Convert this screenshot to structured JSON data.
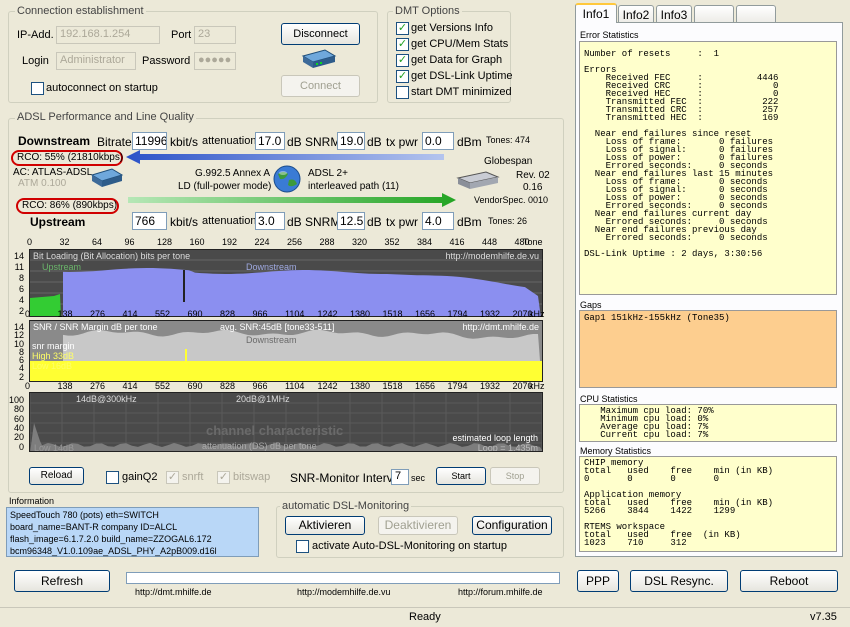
{
  "conn": {
    "title": "Connection establishment",
    "ip_label": "IP-Add.",
    "ip_value": "192.168.1.254",
    "port_label": "Port",
    "port_value": "23",
    "login_label": "Login",
    "login_value": "Administrator",
    "password_label": "Password",
    "password_value": "●●●●●",
    "autoconnect_label": "autoconnect on startup",
    "disconnect": "Disconnect",
    "connect": "Connect"
  },
  "dmt": {
    "title": "DMT Options",
    "opts": [
      {
        "label": "get Versions Info",
        "checked": true
      },
      {
        "label": "get CPU/Mem Stats",
        "checked": true
      },
      {
        "label": "get Data for Graph",
        "checked": true
      },
      {
        "label": "get DSL-Link Uptime",
        "checked": true
      },
      {
        "label": "start DMT minimized",
        "checked": false
      }
    ]
  },
  "adsl": {
    "title": "ADSL Performance and Line Quality",
    "down": {
      "label": "Downstream",
      "bitrate_label": "Bitrate",
      "bitrate": "11996",
      "unit": "kbit/s",
      "att_label": "attenuation",
      "att": "17.0",
      "db": "dB",
      "snrm_label": "SNRM",
      "snrm": "19.0",
      "txpwr_label": "tx pwr",
      "txpwr": "0.0",
      "dbm": "dBm",
      "tones": "Tones: 474",
      "rco": "RCO: 55% (21810kbps)"
    },
    "up": {
      "label": "Upstream",
      "bitrate": "766",
      "att": "3.0",
      "snrm": "12.5",
      "txpwr": "4.0",
      "tones": "Tones: 26",
      "rco": "RCO: 86% (890kbps)"
    },
    "ac": "AC: ATLAS-ADSL",
    "atm": "ATM 0.100",
    "mode1": "G.992.5 Annex A",
    "mode2": "LD (full-power mode)",
    "adsl2": "ADSL 2+",
    "path": "interleaved path (11)",
    "vendor": "Globespan",
    "rev": "Rev. 02",
    "rev2": "0.16",
    "vendorspec": "VendorSpec. 0010"
  },
  "graph": {
    "tone_label": "Tone",
    "khz_label": "kHz",
    "tones": [
      "0",
      "32",
      "64",
      "96",
      "128",
      "160",
      "192",
      "224",
      "256",
      "288",
      "320",
      "352",
      "384",
      "416",
      "448",
      "480"
    ],
    "khz": [
      "0",
      "138",
      "276",
      "414",
      "552",
      "690",
      "828",
      "966",
      "1104",
      "1242",
      "1380",
      "1518",
      "1656",
      "1794",
      "1932",
      "2070"
    ],
    "bit_title": "Bit Loading (Bit Allocation)  bits per tone",
    "bit_url": "http://modemhilfe.de.vu",
    "bit_y": [
      "14",
      "11",
      "8",
      "6",
      "4",
      "2"
    ],
    "up_mark": "Upstream",
    "down_mark": "Downstream",
    "snr_title": "SNR / SNR Margin  dB per tone",
    "snr_avg": "avg. SNR:45dB  [tone33-511]",
    "snr_url": "http://dmt.mhilfe.de",
    "snr_y": [
      "14",
      "12",
      "10",
      "8",
      "6",
      "4",
      "2"
    ],
    "snr_margin": "snr margin",
    "snr_high": "High 33dB",
    "snr_low": "Low  16dB",
    "ch_y": [
      "100",
      "80",
      "60",
      "40",
      "20",
      "0"
    ],
    "ch_a": "14dB@300kHz",
    "ch_b": "20dB@1MHz",
    "ch_title": "channel characteristic",
    "ch_att": "attenuation (DS)  dB per tone",
    "ch_est": "estimated loop length",
    "ch_len": "Loop = 1.435m",
    "ch_low": "Low  14dB"
  },
  "ctrl": {
    "reload": "Reload",
    "gainq2": "gainQ2",
    "snrft": "snrft",
    "bitswap": "bitswap",
    "interval_label": "SNR-Monitor Interval:",
    "interval": "7",
    "sec": "sec",
    "start": "Start",
    "stop": "Stop"
  },
  "info": {
    "title": "Information",
    "lines": [
      "SpeedTouch 780 (pots) eth=SWITCH",
      "board_name=BANT-R   company ID=ALCL",
      "flash_image=6.1.7.2.0  build_name=ZZOGAL6.172",
      "bcm96348_V1.0.109ae_ADSL_PHY_A2pB009.d16l"
    ]
  },
  "auto": {
    "title": "automatic DSL-Monitoring",
    "activate": "Aktivieren",
    "deactivate": "Deaktivieren",
    "config": "Configuration",
    "startup": "activate Auto-DSL-Monitoring on startup"
  },
  "tabs": [
    "Info1",
    "Info2",
    "Info3",
    "",
    ""
  ],
  "err": {
    "title": "Error Statistics",
    "text": "Number of resets     :  1\n\nErrors\n    Received FEC     :          4446\n    Received CRC     :             0\n    Received HEC     :             0\n    Transmitted FEC  :           222\n    Transmitted CRC  :           257\n    Transmitted HEC  :           169\n\n  Near end failures since reset\n    Loss of frame:       0 failures\n    Loss of signal:      0 failures\n    Loss of power:       0 failures\n    Errored seconds:     0 seconds\n  Near end failures last 15 minutes\n    Loss of frame:       0 seconds\n    Loss of signal:      0 seconds\n    Loss of power:       0 seconds\n    Errored seconds:     0 seconds\n  Near end failures current day\n    Errored seconds:     0 seconds\n  Near end failures previous day\n    Errored seconds:     0 seconds\n\nDSL-Link Uptime : 2 days, 3:30:56"
  },
  "gaps": {
    "title": "Gaps",
    "text": "Gap1 151kHz-155kHz (Tone35)"
  },
  "cpu": {
    "title": "CPU Statistics",
    "text": "   Maximum cpu load: 70%\n   Minimum cpu load: 0%\n   Average cpu load: 7%\n   Current cpu load: 7%"
  },
  "mem": {
    "title": "Memory Statistics",
    "text": "CHIP memory\ntotal   used    free    min (in KB)\n0       0       0       0\n\nApplication memory\ntotal   used    free    min (in KB)\n5266    3844    1422    1299\n\nRTEMS workspace\ntotal   used    free  (in KB)\n1023    710     312"
  },
  "bottom": {
    "refresh": "Refresh",
    "link1": "http://dmt.mhilfe.de",
    "link2": "http://modemhilfe.de.vu",
    "link3": "http://forum.mhilfe.de",
    "ppp": "PPP",
    "resync": "DSL Resync.",
    "reboot": "Reboot",
    "status": "Ready",
    "version": "v7.35"
  }
}
